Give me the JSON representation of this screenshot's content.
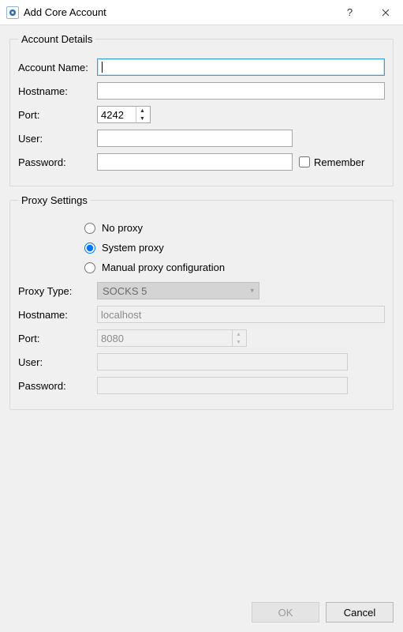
{
  "window": {
    "title": "Add Core Account"
  },
  "groups": {
    "account": {
      "legend": "Account Details",
      "name_label": "Account Name:",
      "name_value": "",
      "host_label": "Hostname:",
      "host_value": "",
      "port_label": "Port:",
      "port_value": "4242",
      "user_label": "User:",
      "user_value": "",
      "pass_label": "Password:",
      "pass_value": "",
      "remember_label": "Remember"
    },
    "proxy": {
      "legend": "Proxy Settings",
      "radio_none": "No proxy",
      "radio_system": "System proxy",
      "radio_manual": "Manual proxy configuration",
      "selected": "system",
      "type_label": "Proxy Type:",
      "type_value": "SOCKS 5",
      "host_label": "Hostname:",
      "host_value": "localhost",
      "port_label": "Port:",
      "port_value": "8080",
      "user_label": "User:",
      "user_value": "",
      "pass_label": "Password:",
      "pass_value": ""
    }
  },
  "buttons": {
    "ok": "OK",
    "cancel": "Cancel"
  }
}
